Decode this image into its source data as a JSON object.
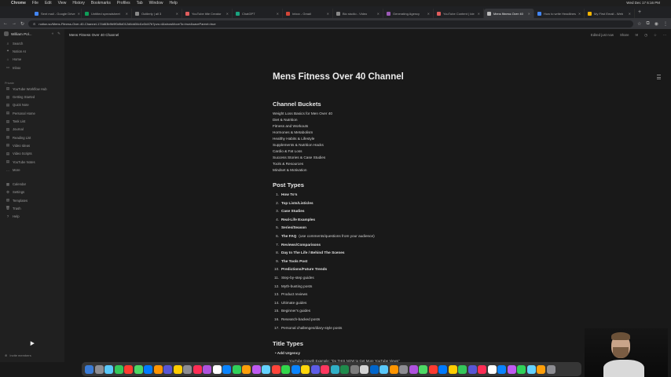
{
  "menubar": {
    "app": "Chrome",
    "items": [
      "File",
      "Edit",
      "View",
      "History",
      "Bookmarks",
      "Profiles",
      "Tab",
      "Window",
      "Help"
    ],
    "clock": "Wed Dec 17 6:16 PM"
  },
  "tabs": [
    {
      "label": "Sent mail - Google Drive",
      "color": "#4285f4",
      "active": false
    },
    {
      "label": "Untitled spreadsheet",
      "color": "#0f9d58",
      "active": false
    },
    {
      "label": "Outlierly | all 3",
      "color": "#888888",
      "active": false
    },
    {
      "label": "YouTube title Creator",
      "color": "#e05d5d",
      "active": false
    },
    {
      "label": "ChatGPT",
      "color": "#19a37f",
      "active": false
    },
    {
      "label": "Inbox - Gmail",
      "color": "#d44638",
      "active": false
    },
    {
      "label": "Bio studio - Video",
      "color": "#888888",
      "active": false
    },
    {
      "label": "Generating Agency",
      "color": "#9b59b6",
      "active": false
    },
    {
      "label": "YouTube Content | Ide",
      "color": "#e05d5d",
      "active": false
    },
    {
      "label": "Mens fitness Over 40",
      "color": "#bbbbbb",
      "active": true
    },
    {
      "label": "How to write Headlines",
      "color": "#4285f4",
      "active": false
    },
    {
      "label": "My First Email - Web",
      "color": "#f4b400",
      "active": false
    }
  ],
  "address": {
    "url": "notion.so/Mens-Fitness-Over-40-Channel-174d63b9b9f0d5d012d6dd34d1e3d47b?pvs=4&showMoveTo=true&saveParent=true"
  },
  "sidebar": {
    "workspace": "William Pol...",
    "top_items": [
      {
        "icon": "⌕",
        "label": "Search"
      },
      {
        "icon": "✦",
        "label": "Notion AI"
      },
      {
        "icon": "⌂",
        "label": "Home"
      },
      {
        "icon": "▭",
        "label": "Inbox"
      }
    ],
    "section_private": "Private",
    "private_items": [
      {
        "icon": "▤",
        "label": "YouTube Workflow Hub"
      },
      {
        "icon": "▤",
        "label": "Getting Started"
      },
      {
        "icon": "▤",
        "label": "Quick Note"
      },
      {
        "icon": "▤",
        "label": "Personal Home"
      },
      {
        "icon": "▤",
        "label": "Task List"
      },
      {
        "icon": "▤",
        "label": "Journal"
      },
      {
        "icon": "▤",
        "label": "Reading List"
      },
      {
        "icon": "▤",
        "label": "Video Ideas"
      },
      {
        "icon": "▤",
        "label": "Video Scripts"
      },
      {
        "icon": "▤",
        "label": "YouTube Notes"
      },
      {
        "icon": "…",
        "label": "More"
      }
    ],
    "bottom_items": [
      {
        "icon": "▦",
        "label": "Calendar"
      },
      {
        "icon": "⚙",
        "label": "Settings"
      },
      {
        "icon": "▧",
        "label": "Templates"
      },
      {
        "icon": "🗑",
        "label": "Trash"
      },
      {
        "icon": "?",
        "label": "Help"
      }
    ],
    "invite": "Invite members"
  },
  "page_header": {
    "breadcrumb": "Mens Fitness Over 40 Channel",
    "edited": "Edited just now",
    "share": "Share"
  },
  "doc": {
    "title": "Mens Fitness Over 40 Channel",
    "buckets_heading": "Channel Buckets",
    "buckets": [
      "Weight Loss Basics for Men Over 40",
      "Diet & Nutrition",
      "Fitness and Workouts",
      "Hormones & Metabolism",
      "Healthy Habits & Lifestyle",
      "Supplements & Nutrition Hacks",
      "Cardio & Fat Loss",
      "Success Stories & Case Studies",
      "Tools & Resources",
      "Mindset & Motivation"
    ],
    "post_types_heading": "Post Types",
    "post_types": [
      {
        "n": "1.",
        "bold": "How To's",
        "rest": ""
      },
      {
        "n": "2.",
        "bold": "Top Lists/Listicles",
        "rest": ""
      },
      {
        "n": "3.",
        "bold": "Case Studies",
        "rest": ""
      },
      {
        "n": "4.",
        "bold": "Real-Life Examples",
        "rest": ""
      },
      {
        "n": "5.",
        "bold": "Series/Season",
        "rest": ""
      },
      {
        "n": "6.",
        "bold": "The FAQ",
        "rest": "(use comments/questions from your audience)"
      },
      {
        "n": "7.",
        "bold": "Reviews/Comparisons",
        "rest": ""
      },
      {
        "n": "8.",
        "bold": "Day In The Life / Behind The Scenes",
        "rest": ""
      },
      {
        "n": "9.",
        "bold": "The Tools Post",
        "rest": ""
      },
      {
        "n": "10.",
        "bold": "Predictions/Future Trends",
        "rest": ""
      },
      {
        "n": "11.",
        "bold": "",
        "rest": "Step-by-step guides"
      },
      {
        "n": "12.",
        "bold": "",
        "rest": "Myth-busting posts"
      },
      {
        "n": "13.",
        "bold": "",
        "rest": "Product reviews"
      },
      {
        "n": "14.",
        "bold": "",
        "rest": "Ultimate guides"
      },
      {
        "n": "15.",
        "bold": "",
        "rest": "Beginner's guides"
      },
      {
        "n": "16.",
        "bold": "",
        "rest": "Research-backed posts"
      },
      {
        "n": "17.",
        "bold": "",
        "rest": "Personal challenges/diary-style posts"
      }
    ],
    "title_types_heading": "Title Types",
    "title_types": [
      {
        "label": "Add Urgency",
        "sub": "YouTube Growth Example: \"Do THIS NOW to Get More YouTube Views\""
      }
    ]
  },
  "dock_colors": [
    "#3a7bd5",
    "#8e8e93",
    "#5ac8fa",
    "#34c759",
    "#ff3b30",
    "#4cd964",
    "#007aff",
    "#ff9500",
    "#5856d6",
    "#ffcc00",
    "#8e8e93",
    "#ff2d55",
    "#af52de",
    "#ffffff",
    "#0a84ff",
    "#30d158",
    "#ff9f0a",
    "#bf5af2",
    "#64d2ff",
    "#ff453a",
    "#32d74b",
    "#0a84ff",
    "#ffd60a",
    "#5e5ce6",
    "#ff375f",
    "#30b0c7",
    "#1f8b4c",
    "#7d7d7d",
    "#d4d4d4",
    "#0066cc",
    "#5ac8fa",
    "#ff9500",
    "#8e8e93",
    "#af52de",
    "#4cd964",
    "#ff3b30",
    "#007aff",
    "#ffcc00",
    "#34c759",
    "#5856d6",
    "#ff2d55",
    "#ffffff",
    "#0a84ff",
    "#bf5af2",
    "#30d158",
    "#64d2ff",
    "#ff9f0a",
    "#8e8e93"
  ]
}
